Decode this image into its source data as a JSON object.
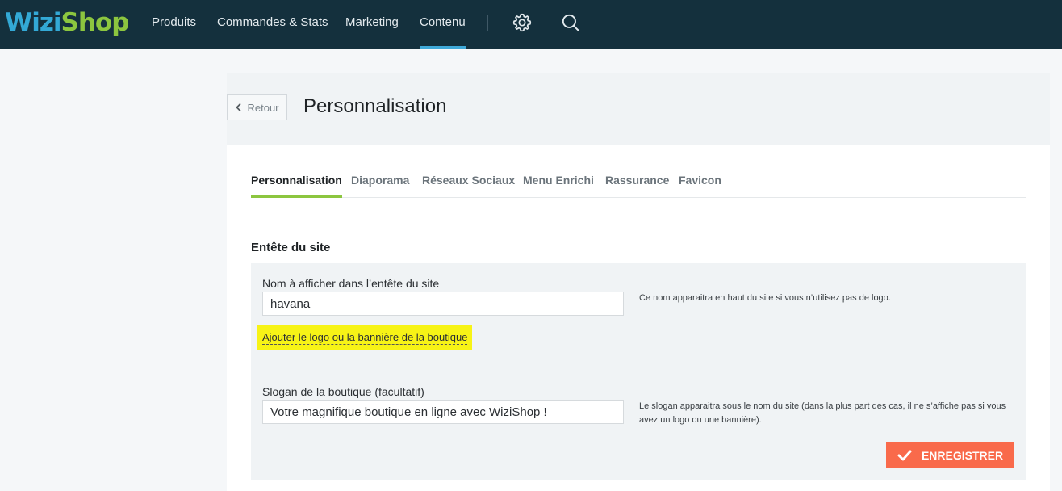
{
  "brand": {
    "part1": "Wizi",
    "part2": "Shop"
  },
  "nav": {
    "items": [
      {
        "label": "Produits",
        "active": false
      },
      {
        "label": "Commandes & Stats",
        "active": false
      },
      {
        "label": "Marketing",
        "active": false
      },
      {
        "label": "Contenu",
        "active": true
      }
    ],
    "icons": [
      "gear-icon",
      "search-icon"
    ]
  },
  "header": {
    "back_label": "Retour",
    "title": "Personnalisation"
  },
  "tabs": [
    {
      "label": "Personnalisation",
      "active": true
    },
    {
      "label": "Diaporama",
      "active": false
    },
    {
      "label": "Réseaux Sociaux",
      "active": false
    },
    {
      "label": "Menu Enrichi",
      "active": false
    },
    {
      "label": "Rassurance",
      "active": false
    },
    {
      "label": "Favicon",
      "active": false
    }
  ],
  "section": {
    "title": "Entête du site",
    "name_field": {
      "label": "Nom à afficher dans l’entête du site",
      "value": "havana",
      "help": "Ce nom apparaitra en haut du site si vous n’utilisez pas de logo."
    },
    "logo_link": "Ajouter le logo ou la bannière de la boutique",
    "slogan_field": {
      "label": "Slogan de la boutique (facultatif)",
      "value": "Votre magnifique boutique en ligne avec WiziShop !",
      "help": "Le slogan apparaitra sous le nom du site (dans la plus part des cas, il ne s’affiche pas si vous avez un logo ou une bannière)."
    },
    "save_label": "ENREGISTRER"
  },
  "colors": {
    "topbar": "#14303d",
    "nav_active_underline": "#3fa9d9",
    "tab_active_underline": "#8cc63f",
    "highlight": "#f7f316",
    "save_button": "#f96a4b"
  }
}
